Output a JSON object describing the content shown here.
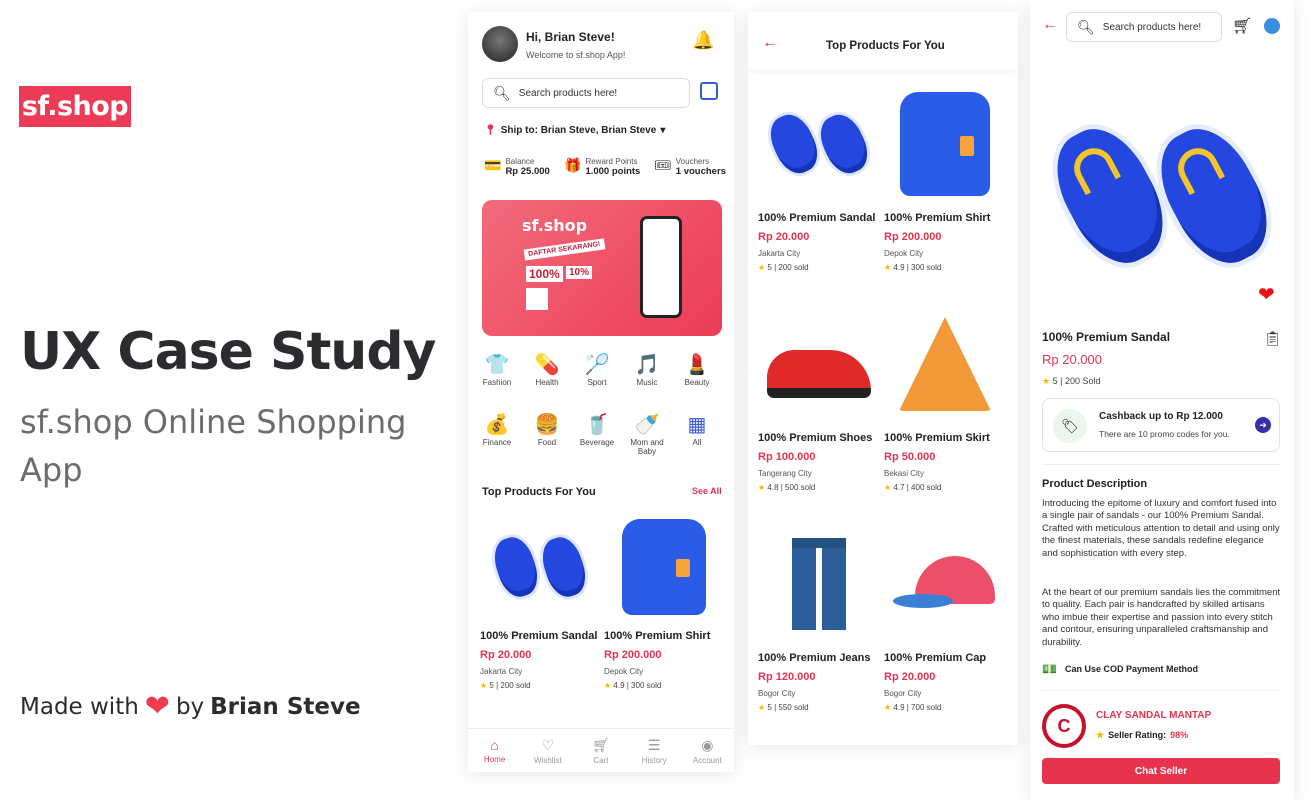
{
  "intro": {
    "logo": "sf.shop",
    "title": "UX Case Study",
    "subtitle": "sf.shop Online Shopping App",
    "made_prefix": "Made with",
    "made_by": "by",
    "author": "Brian Steve"
  },
  "home": {
    "greeting": "Hi, Brian Steve!",
    "welcome": "Welcome to sf.shop App!",
    "search_placeholder": "Search products here!",
    "ship_to": "Ship to: Brian Steve, Brian Steve",
    "balance_label": "Balance",
    "balance_value": "Rp 25.000",
    "points_label": "Reward Points",
    "points_value": "1.000 points",
    "vouchers_label": "Vouchers",
    "vouchers_value": "1 vouchers",
    "banner_logo": "sf.shop",
    "banner_badge": "DAFTAR SEKARANG!",
    "banner_pct1": "100%",
    "banner_pct2": "10%",
    "categories_row1": [
      "Fashion",
      "Health",
      "Sport",
      "Music",
      "Beauty"
    ],
    "categories_row2": [
      "Finance",
      "Food",
      "Beverage",
      "Mom and Baby",
      "All"
    ],
    "section_title": "Top Products For You",
    "see_all": "See All",
    "products": [
      {
        "name": "100% Premium Sandal",
        "price": "Rp 20.000",
        "city": "Jakarta City",
        "rating": "5 | 200 sold"
      },
      {
        "name": "100% Premium Shirt",
        "price": "Rp 200.000",
        "city": "Depok City",
        "rating": "4.9 | 300 sold"
      }
    ],
    "nav": [
      "Home",
      "Wishlist",
      "Cart",
      "History",
      "Account"
    ]
  },
  "top": {
    "title": "Top Products For You",
    "products": [
      {
        "name": "100% Premium Sandal",
        "price": "Rp 20.000",
        "city": "Jakarta City",
        "rating": "5 | 200 sold"
      },
      {
        "name": "100% Premium Shirt",
        "price": "Rp 200.000",
        "city": "Depok City",
        "rating": "4.9 | 300 sold"
      },
      {
        "name": "100% Premium Shoes",
        "price": "Rp 100.000",
        "city": "Tangerang City",
        "rating": "4.8 | 500 sold"
      },
      {
        "name": "100% Premium Skirt",
        "price": "Rp 50.000",
        "city": "Bekasi City",
        "rating": "4.7 | 400 sold"
      },
      {
        "name": "100% Premium Jeans",
        "price": "Rp 120.000",
        "city": "Bogor City",
        "rating": "5 | 550 sold"
      },
      {
        "name": "100% Premium Cap",
        "price": "Rp 20.000",
        "city": "Bogor City",
        "rating": "4.9 | 700 sold"
      }
    ]
  },
  "detail": {
    "search_placeholder": "Search products here!",
    "name": "100% Premium Sandal",
    "price": "Rp 20.000",
    "rating": "5 | 200 Sold",
    "cashback_title": "Cashback up to Rp 12.000",
    "cashback_sub": "There are 10 promo codes for you.",
    "desc_title": "Product Description",
    "desc_p1": "Introducing the epitome of luxury and comfort fused into a single pair of sandals - our 100% Premium Sandal. Crafted with meticulous attention to detail and using only the finest materials, these sandals redefine elegance and sophistication with every step.",
    "desc_p2": "At the heart of our premium sandals lies the commitment to quality. Each pair is handcrafted by skilled artisans who imbue their expertise and passion into every stitch and contour, ensuring unparalleled craftsmanship and durability.",
    "cod": "Can Use COD Payment Method",
    "seller_name": "CLAY SANDAL MANTAP",
    "seller_rating_label": "Seller Rating:",
    "seller_rating_value": "98%",
    "chat": "Chat Seller"
  }
}
